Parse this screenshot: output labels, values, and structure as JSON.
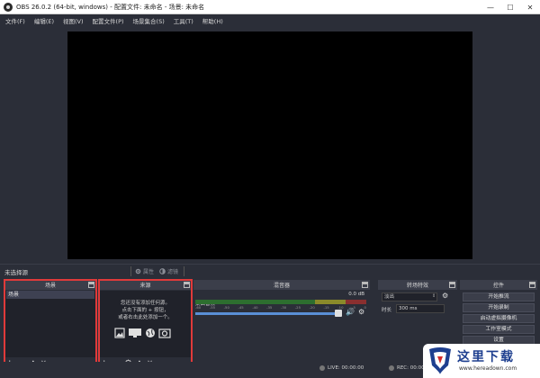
{
  "window": {
    "title": "OBS 26.0.2 (64-bit, windows) - 配置文件: 未命名 - 场景: 未命名",
    "min": "—",
    "max": "☐",
    "close": "✕"
  },
  "menu": [
    "文件(F)",
    "编辑(E)",
    "视图(V)",
    "配置文件(P)",
    "场景集合(S)",
    "工具(T)",
    "帮助(H)"
  ],
  "source_toolbar": {
    "no_source": "未选择源",
    "properties": "属性",
    "filters": "滤镜"
  },
  "scenes": {
    "title": "场景",
    "items": [
      "场景"
    ]
  },
  "sources": {
    "title": "来源",
    "empty_line1": "您还没有添加任何源。",
    "empty_line2": "点击下面的 + 按钮，",
    "empty_line3": "或者右击此处添加一个。"
  },
  "mixer": {
    "title": "混音器",
    "track_name": "桌面音频",
    "track_db": "0.0 dB",
    "ticks": [
      "-60",
      "-55",
      "-50",
      "-45",
      "-40",
      "-35",
      "-30",
      "-25",
      "-20",
      "-15",
      "-10",
      "-5",
      "0"
    ]
  },
  "transitions": {
    "title": "转场特效",
    "selected": "淡出",
    "duration_label": "时长",
    "duration_value": "300 ms"
  },
  "controls": {
    "title": "控件",
    "buttons": [
      "开始推流",
      "开始录制",
      "启动虚拟摄像机",
      "工作室模式",
      "设置"
    ]
  },
  "status": {
    "live": "LIVE: 00:00:00",
    "rec": "REC: 00:00:00"
  },
  "watermark": {
    "text": "这里下载",
    "url": "www.hereadown.com"
  },
  "colors": {
    "highlight": "#e03a3a",
    "background": "#2b2e38"
  }
}
